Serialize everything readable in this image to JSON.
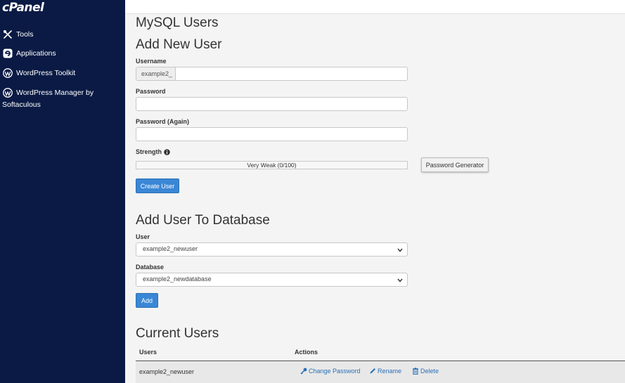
{
  "sidebar": {
    "logo": "cPanel",
    "items": [
      {
        "label": "Tools",
        "icon": "tools-icon"
      },
      {
        "label": "Applications",
        "icon": "applications-icon"
      },
      {
        "label": "WordPress Toolkit",
        "icon": "wordpress-icon"
      },
      {
        "label_line1": "WordPress Manager by",
        "label_line2": "Softaculous",
        "icon": "wordpress-icon"
      }
    ]
  },
  "page": {
    "title": "MySQL Users"
  },
  "add_user": {
    "heading": "Add New User",
    "username_label": "Username",
    "username_prefix": "example2_",
    "username_value": "",
    "password_label": "Password",
    "password_value": "",
    "password_again_label": "Password (Again)",
    "password_again_value": "",
    "strength_label": "Strength",
    "strength_text": "Very Weak (0/100)",
    "strength_score": 0,
    "generator_button": "Password Generator",
    "create_button": "Create User"
  },
  "add_to_db": {
    "heading": "Add User To Database",
    "user_label": "User",
    "user_selected": "example2_newuser",
    "database_label": "Database",
    "database_selected": "example2_newdatabase",
    "add_button": "Add"
  },
  "current_users": {
    "heading": "Current Users",
    "columns": [
      "Users",
      "Actions"
    ],
    "rows": [
      {
        "user": "example2_newuser",
        "actions": [
          "Change Password",
          "Rename",
          "Delete"
        ]
      }
    ]
  },
  "colors": {
    "sidebar_bg": "#0a1a44",
    "primary": "#3a87d6",
    "link": "#2a6fb5"
  }
}
